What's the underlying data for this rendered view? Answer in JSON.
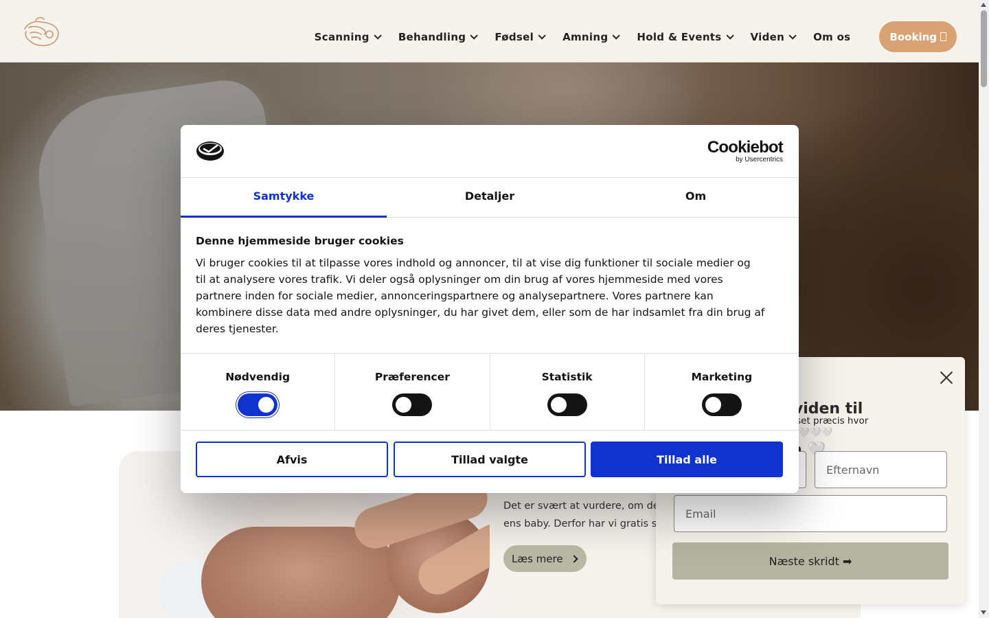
{
  "header": {
    "nav": [
      {
        "label": "Scanning",
        "dropdown": true
      },
      {
        "label": "Behandling",
        "dropdown": true
      },
      {
        "label": "Fødsel",
        "dropdown": true
      },
      {
        "label": "Amning",
        "dropdown": true
      },
      {
        "label": "Hold & Events",
        "dropdown": true
      },
      {
        "label": "Viden",
        "dropdown": true
      },
      {
        "label": "Om os",
        "dropdown": false
      }
    ],
    "booking_label": "Booking",
    "booking_icon": "calendar-icon",
    "colors": {
      "background": "#f6f2ec",
      "booking": "#d8a274"
    }
  },
  "section": {
    "text_line1": "Det er svært at vurdere, om den en",
    "text_line2": "ens baby. Derfor har vi gratis screen",
    "read_more": "Læs mere"
  },
  "popup": {
    "title_line1": "passet viden til",
    "title_line2": "rerejsen 🤍",
    "subtitle_line1": "bakken, tilpasset præcis hvor",
    "subtitle_line2": "ældrerejsen🤍🤍🤍🤍",
    "last_name_placeholder": "Efternavn",
    "email_placeholder": "Email",
    "next_button": "Næste skridt ➡"
  },
  "cookie": {
    "brand": "Cookiebot",
    "brand_sub": "by Usercentrics",
    "tabs": [
      "Samtykke",
      "Detaljer",
      "Om"
    ],
    "active_tab": "Samtykke",
    "title": "Denne hjemmeside bruger cookies",
    "body_lines": [
      "Vi bruger cookies til at tilpasse vores indhold og annoncer, til at vise dig funktioner til sociale medier og",
      "til at analysere vores trafik. Vi deler også oplysninger om din brug af vores hjemmeside med vores",
      "partnere inden for sociale medier, annonceringspartnere og analysepartnere. Vores partnere kan",
      "kombinere disse data med andre oplysninger, du har givet dem, eller som de har indsamlet fra din brug af",
      "deres tjenester."
    ],
    "categories": [
      {
        "label": "Nødvendig",
        "on": true
      },
      {
        "label": "Præferencer",
        "on": false
      },
      {
        "label": "Statistik",
        "on": false
      },
      {
        "label": "Marketing",
        "on": false
      }
    ],
    "buttons": {
      "deny": "Afvis",
      "allow_selected": "Tillad valgte",
      "allow_all": "Tillad alle"
    },
    "colors": {
      "accent": "#1032cf",
      "text": "#141414"
    }
  }
}
